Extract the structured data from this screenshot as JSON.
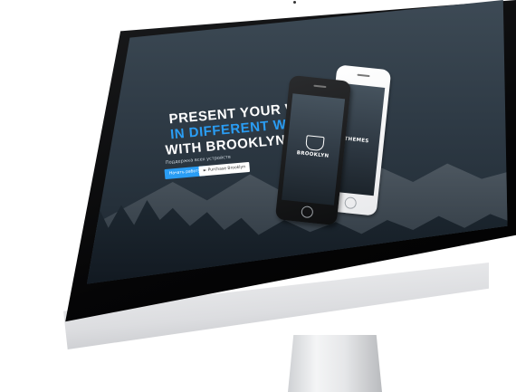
{
  "hero": {
    "line1": "PRESENT YOUR WEB",
    "line2": "IN DIFFERENT WAYS",
    "line3": "WITH BROOKLYN!",
    "subtitle": "Поддержка всех устройств",
    "primary_button": "Начать работу",
    "secondary_button": "► Purchase Brooklyn"
  },
  "phones": {
    "black_logo": "BROOKLYN",
    "white_logo": "THEMES"
  },
  "colors": {
    "accent": "#2a9df4",
    "text_light": "#ffffff",
    "screen_bg": "#2f3b46"
  }
}
